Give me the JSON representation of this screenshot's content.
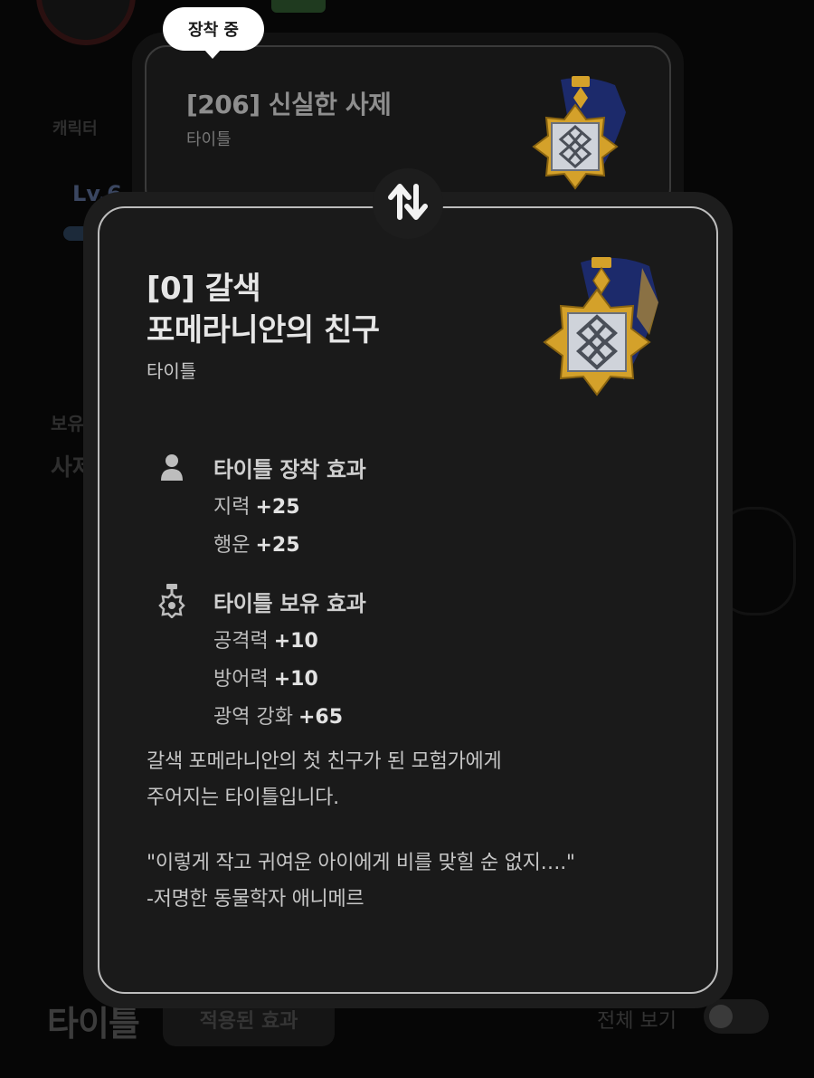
{
  "background": {
    "character_label": "캐릭터",
    "level_label": "Lv.6",
    "side_label_a": "보유",
    "side_label_b": "사제",
    "footer_title": "타이틀",
    "applied_effects_label": "적용된 효과",
    "view_all_label": "전체 보기",
    "view_all_toggle_on": false
  },
  "equipped": {
    "badge": "장착 중",
    "name": "[206] 신실한 사제",
    "type": "타이틀",
    "icon": "medal-icon"
  },
  "swap": {
    "icon": "swap-arrows-icon"
  },
  "title": {
    "name": "[0] 갈색\n포메라니안의 친구",
    "type": "타이틀",
    "icon": "medal-icon"
  },
  "equip_effect": {
    "label": "타이틀 장착 효과",
    "icon": "person-icon",
    "stats": [
      {
        "name": "지력",
        "value": "+25"
      },
      {
        "name": "행운",
        "value": "+25"
      }
    ]
  },
  "own_effect": {
    "label": "타이틀 보유 효과",
    "icon": "medal-gear-icon",
    "stats": [
      {
        "name": "공격력",
        "value": "+10"
      },
      {
        "name": "방어력",
        "value": "+10"
      },
      {
        "name": "광역 강화",
        "value": "+65"
      }
    ]
  },
  "description": "갈색 포메라니안의 첫 친구가 된 모험가에게\n주어지는 타이틀입니다.",
  "quote": "\"이렇게 작고 귀여운 아이에게 비를 맞힐 순 없지….\"\n-저명한 동물학자 애니메르",
  "colors": {
    "card_border": "#bdbdbd",
    "medal_gold": "#d4a12a",
    "medal_navy": "#1c2a6b",
    "medal_silver": "#bfc4cc"
  }
}
